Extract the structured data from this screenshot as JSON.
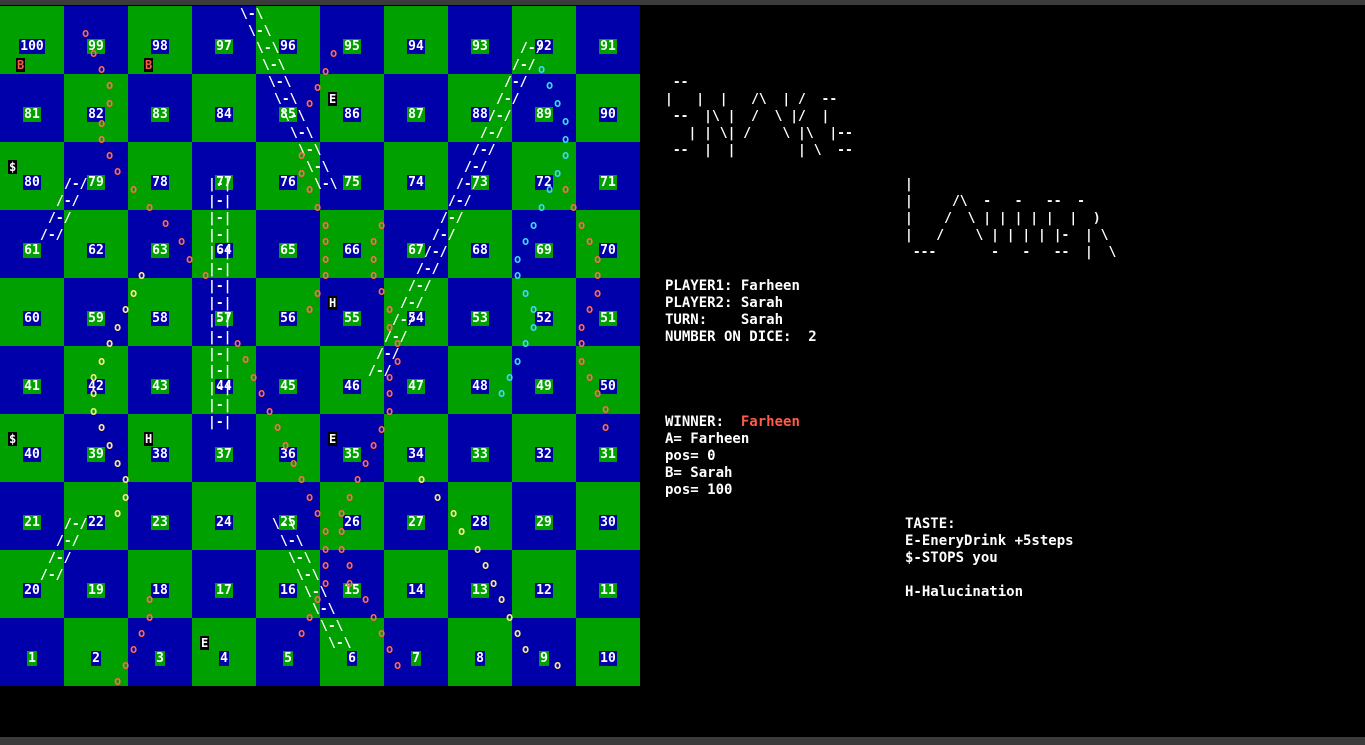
{
  "board": {
    "rows": [
      [
        "100",
        "99",
        "98",
        "97",
        "96",
        "95",
        "94",
        "93",
        "92",
        "91"
      ],
      [
        "81",
        "82",
        "83",
        "84",
        "85",
        "86",
        "87",
        "88",
        "89",
        "90"
      ],
      [
        "80",
        "79",
        "78",
        "77",
        "76",
        "75",
        "74",
        "73",
        "72",
        "71"
      ],
      [
        "61",
        "62",
        "63",
        "64",
        "65",
        "66",
        "67",
        "68",
        "69",
        "70"
      ],
      [
        "60",
        "59",
        "58",
        "57",
        "56",
        "55",
        "54",
        "53",
        "52",
        "51"
      ],
      [
        "41",
        "42",
        "43",
        "44",
        "45",
        "46",
        "47",
        "48",
        "49",
        "50"
      ],
      [
        "40",
        "39",
        "38",
        "37",
        "36",
        "35",
        "34",
        "33",
        "32",
        "31"
      ],
      [
        "21",
        "22",
        "23",
        "24",
        "25",
        "26",
        "27",
        "28",
        "29",
        "30"
      ],
      [
        "20",
        "19",
        "18",
        "17",
        "16",
        "15",
        "14",
        "13",
        "12",
        "11"
      ],
      [
        "1",
        "2",
        "3",
        "4",
        "5",
        "6",
        "7",
        "8",
        "9",
        "10"
      ]
    ],
    "colors": {
      "green": "#00a000",
      "blue": "#0000aa",
      "orange_snake": "#ff6a50",
      "cyan_snake": "#3fd5ff",
      "yellow_snake": "#ffe88a"
    },
    "markers": [
      "B",
      "B",
      "E",
      "$",
      "H",
      "$",
      "H",
      "E",
      "E"
    ],
    "ladder_rail": "|-|",
    "ladder_up": "/-/",
    "ladder_down": "\\-\\"
  },
  "title": {
    "snake_ascii": " --\n|   |  |   /\\  | /  --\n --  |\\ |  /  \\ |/  |\n   | | \\| /    \\ |\\  |--\n --  |  |        | \\  --",
    "ladder_ascii": "|\n|     /\\  -   -   --  -\n|    /  \\ | | | | |  |  )\n|   /    \\ | | | | |-  | \\\n ---       -   -   --  |  \\"
  },
  "status": {
    "player1_label": "PLAYER1:",
    "player1_name": "Farheen",
    "player2_label": "PLAYER2:",
    "player2_name": "Sarah",
    "turn_label": "TURN:",
    "turn_name": "Sarah",
    "dice_label": "NUMBER ON DICE:",
    "dice_value": "2"
  },
  "result": {
    "winner_label": "WINNER:",
    "winner_name": "Farheen",
    "a_line": "A= Farheen",
    "a_pos": "pos= 0",
    "b_line": "B= Sarah",
    "b_pos": "pos= 100"
  },
  "legend": {
    "heading": "TASTE:",
    "energy": "E-EneryDrink +5steps",
    "stop": "$-STOPS you",
    "halluc": "H-Halucination"
  }
}
